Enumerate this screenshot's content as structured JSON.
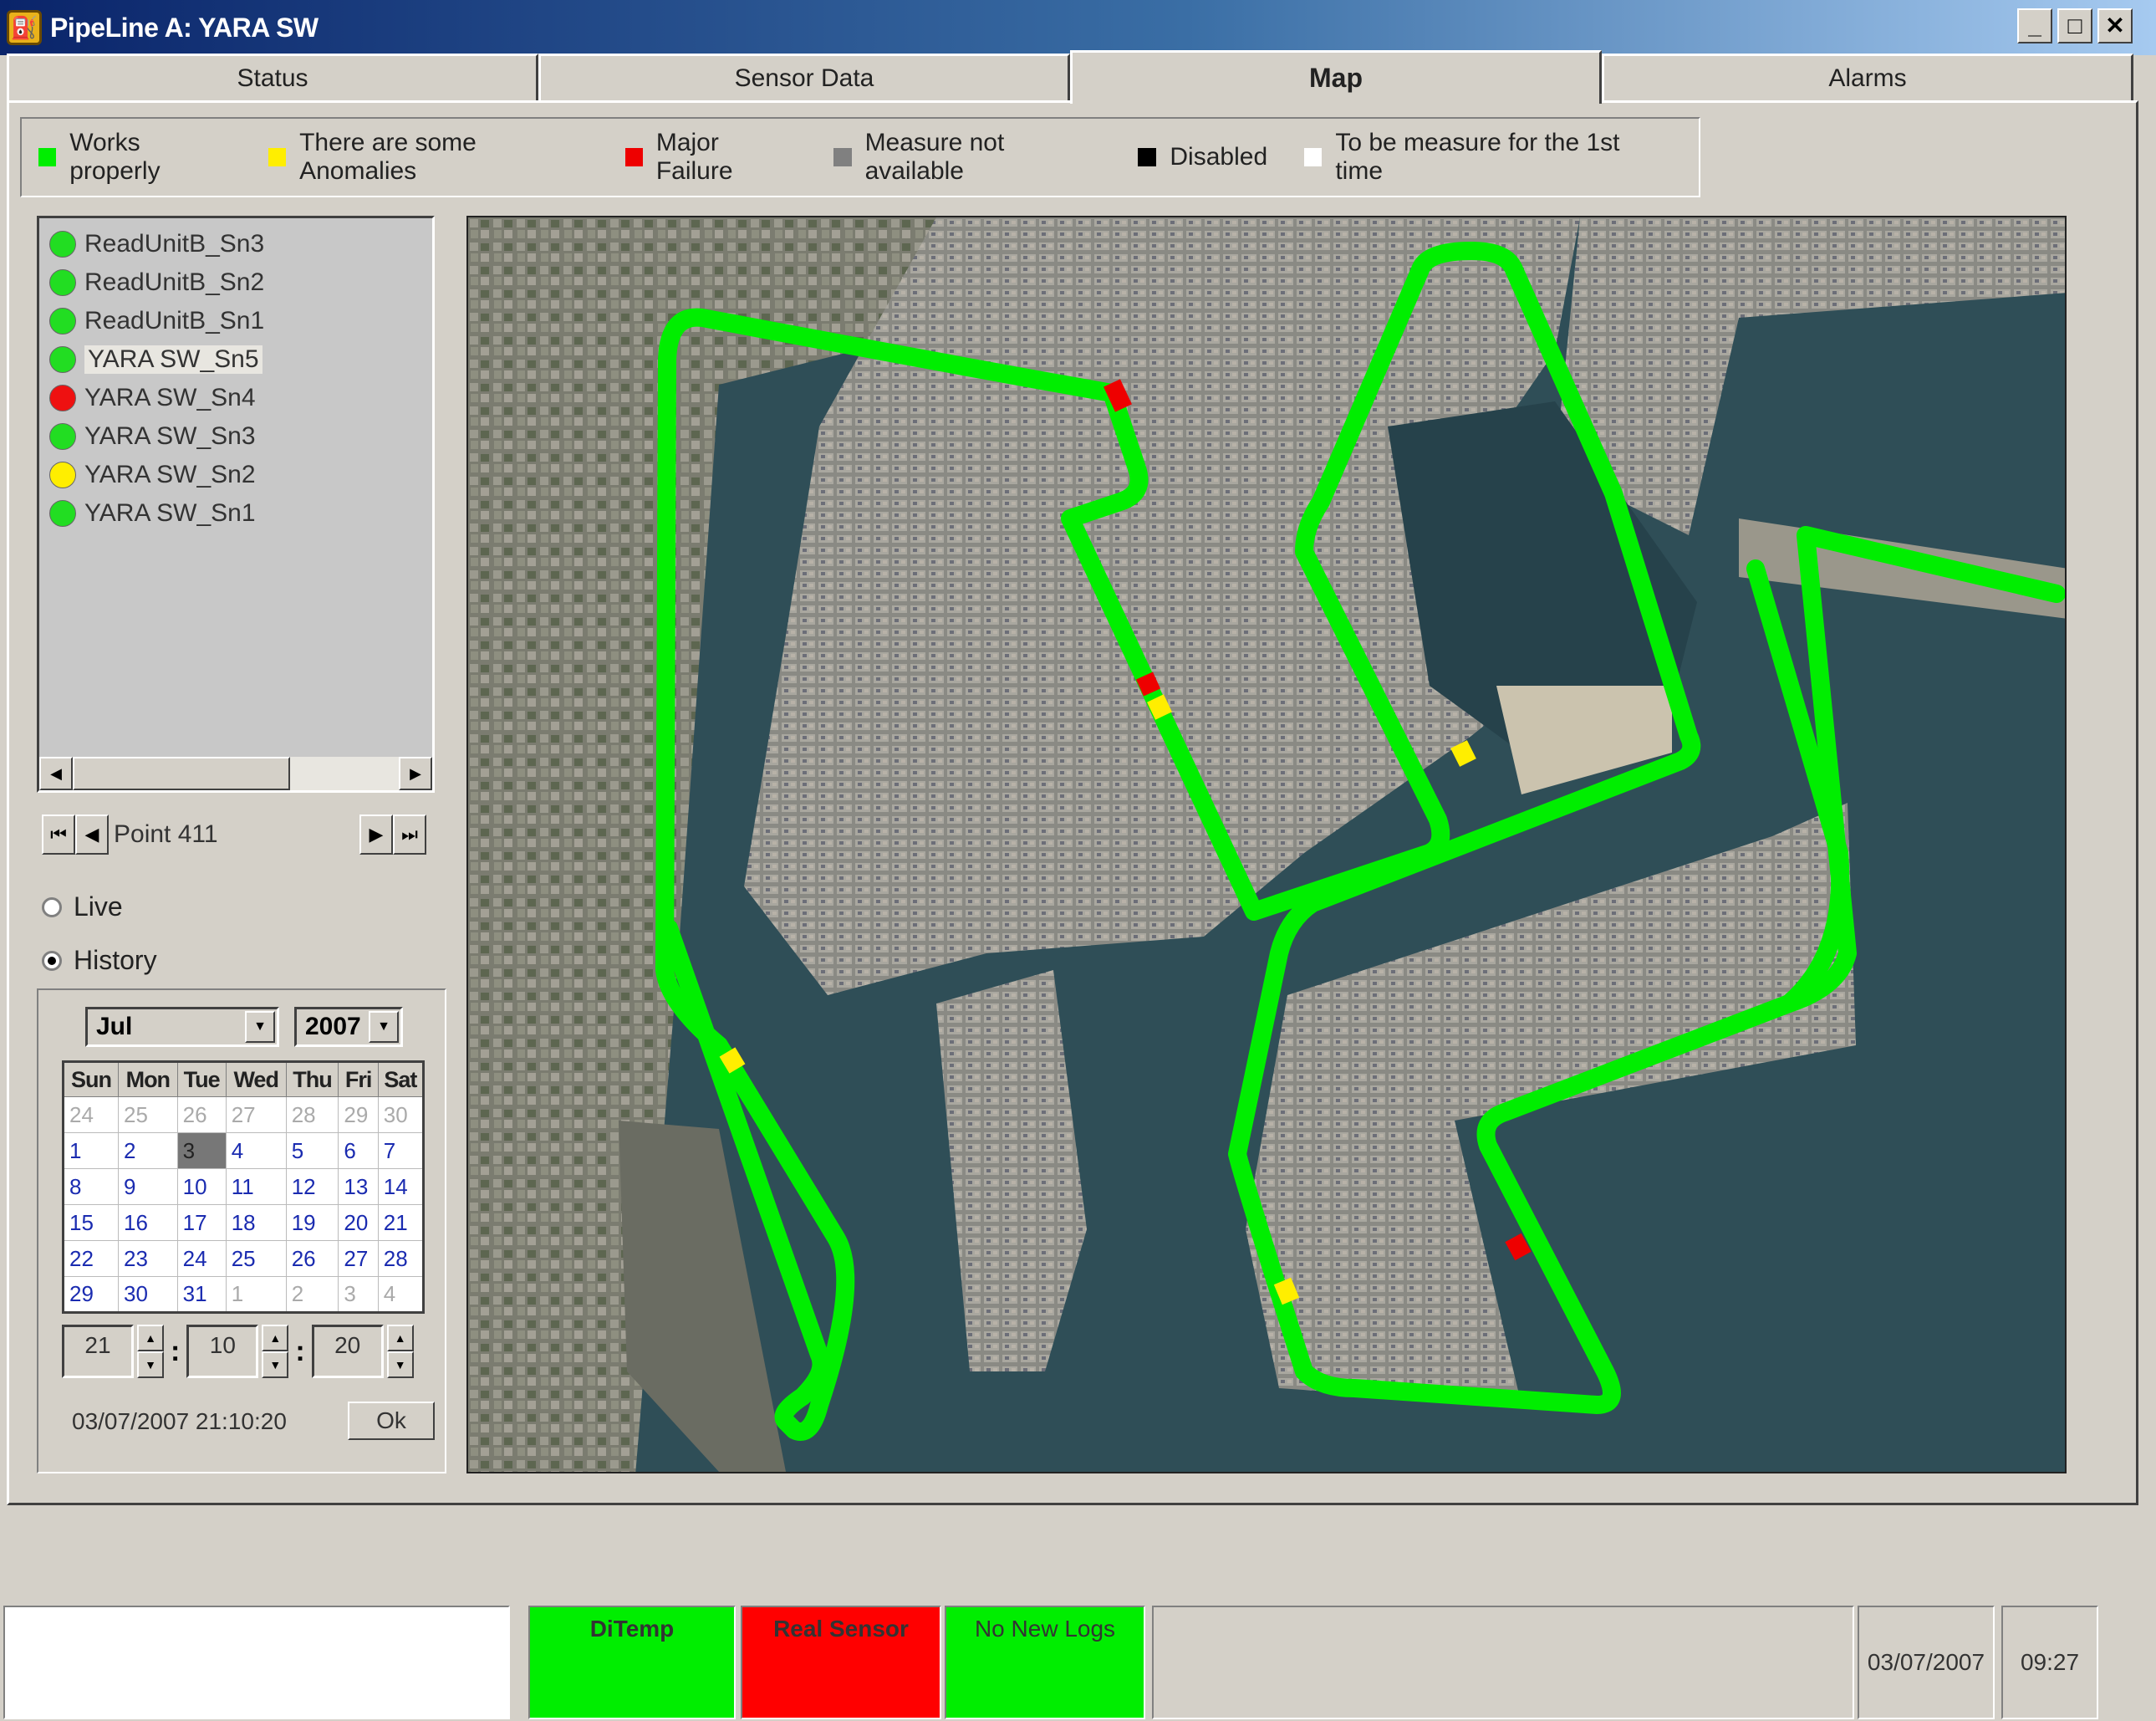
{
  "window": {
    "title": "PipeLine A: YARA SW",
    "app_icon": "oil-drum-icon"
  },
  "tabs": [
    {
      "label": "Status",
      "active": false
    },
    {
      "label": "Sensor Data",
      "active": false
    },
    {
      "label": "Map",
      "active": true
    },
    {
      "label": "Alarms",
      "active": false
    }
  ],
  "legend": [
    {
      "label": "Works properly",
      "color": "#00ee00"
    },
    {
      "label": "There are some Anomalies",
      "color": "#ffee00"
    },
    {
      "label": "Major Failure",
      "color": "#ee0000"
    },
    {
      "label": "Measure not available",
      "color": "#808080"
    },
    {
      "label": "Disabled",
      "color": "#000000"
    },
    {
      "label": "To be measure for the 1st time",
      "color": "#ffffff"
    }
  ],
  "sensors": [
    {
      "label": "ReadUnitB_Sn3",
      "status": "ok",
      "color": "#22dd22"
    },
    {
      "label": "ReadUnitB_Sn2",
      "status": "ok",
      "color": "#22dd22"
    },
    {
      "label": "ReadUnitB_Sn1",
      "status": "ok",
      "color": "#22dd22"
    },
    {
      "label": "YARA SW_Sn5",
      "status": "ok",
      "color": "#22dd22",
      "selected": true
    },
    {
      "label": "YARA SW_Sn4",
      "status": "failure",
      "color": "#ee1111"
    },
    {
      "label": "YARA SW_Sn3",
      "status": "ok",
      "color": "#22dd22"
    },
    {
      "label": "YARA SW_Sn2",
      "status": "anomaly",
      "color": "#ffee00"
    },
    {
      "label": "YARA SW_Sn1",
      "status": "ok",
      "color": "#22dd22"
    }
  ],
  "point_nav": {
    "label": "Point 411"
  },
  "mode": {
    "live_label": "Live",
    "history_label": "History",
    "selected": "History"
  },
  "date_picker": {
    "month": "Jul",
    "year": "2007",
    "weekdays": [
      "Sun",
      "Mon",
      "Tue",
      "Wed",
      "Thu",
      "Fri",
      "Sat"
    ],
    "weeks": [
      [
        "24",
        "25",
        "26",
        "27",
        "28",
        "29",
        "30"
      ],
      [
        "1",
        "2",
        "3",
        "4",
        "5",
        "6",
        "7"
      ],
      [
        "8",
        "9",
        "10",
        "11",
        "12",
        "13",
        "14"
      ],
      [
        "15",
        "16",
        "17",
        "18",
        "19",
        "20",
        "21"
      ],
      [
        "22",
        "23",
        "24",
        "25",
        "26",
        "27",
        "28"
      ],
      [
        "29",
        "30",
        "31",
        "1",
        "2",
        "3",
        "4"
      ]
    ],
    "today": "3",
    "hour": "21",
    "minute": "10",
    "second": "20",
    "datetime_text": "03/07/2007 21:10:20",
    "ok_label": "Ok"
  },
  "map": {
    "pipeline_color": "#00ee00",
    "anomaly_color": "#ffee00",
    "failure_color": "#ee0000"
  },
  "statusbar": {
    "panes": [
      {
        "label": "DiTemp",
        "color": "#00ee00"
      },
      {
        "label": "Real Sensor",
        "color": "#ff0000"
      },
      {
        "label": "No New Logs",
        "color": "#00ee00"
      }
    ],
    "date": "03/07/2007",
    "time": "09:27"
  }
}
